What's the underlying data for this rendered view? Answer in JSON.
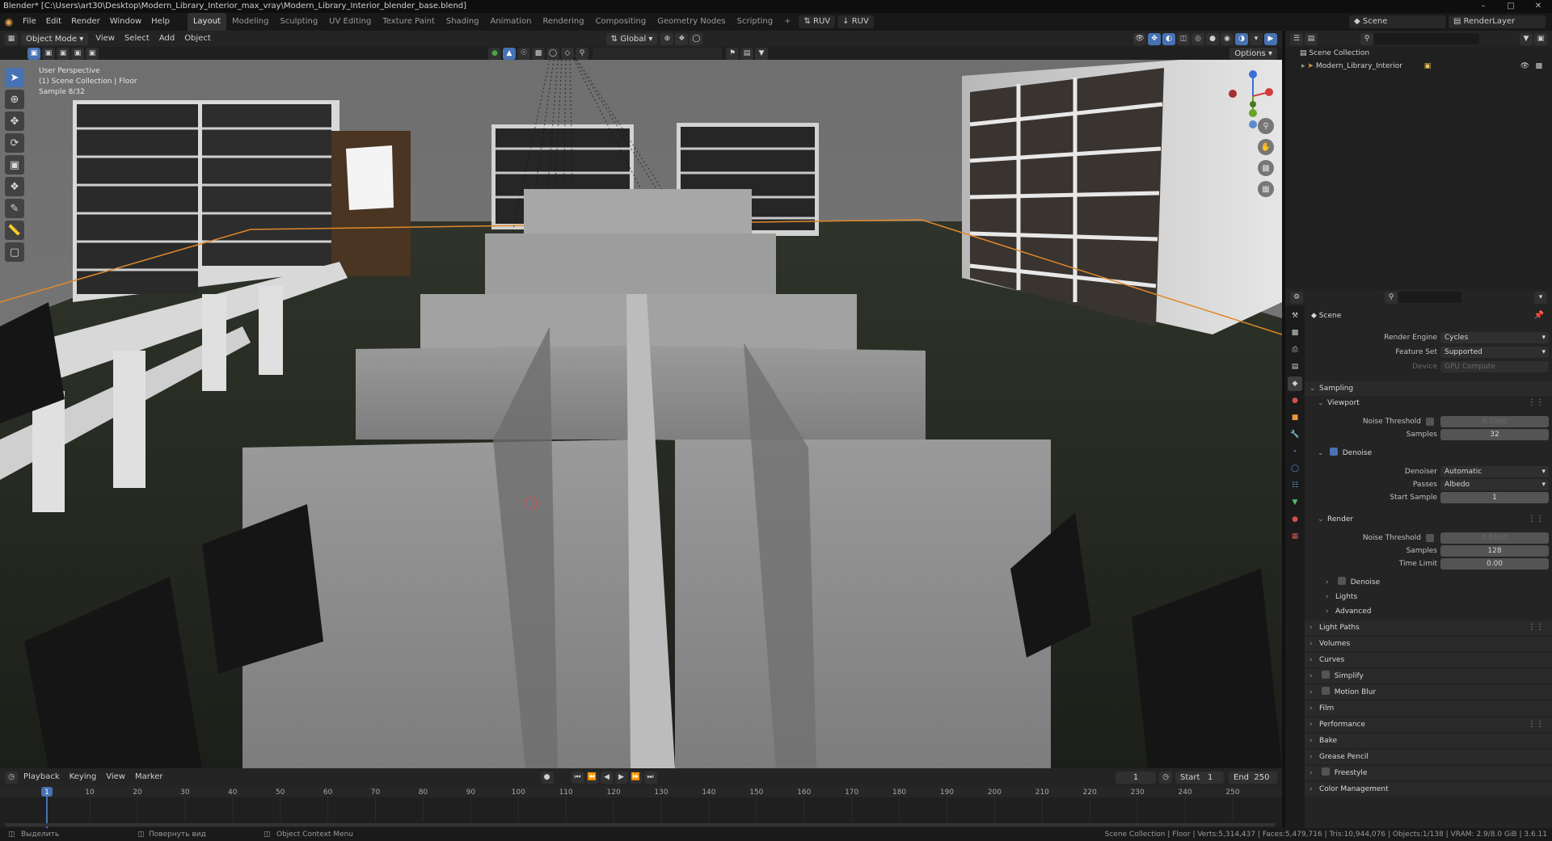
{
  "window": {
    "title": "Blender* [C:\\Users\\art30\\Desktop\\Modern_Library_Interior_max_vray\\Modern_Library_Interior_blender_base.blend]",
    "controls": [
      "–",
      "□",
      "✕"
    ]
  },
  "menubar": {
    "menus": [
      "File",
      "Edit",
      "Render",
      "Window",
      "Help"
    ],
    "workspaces": [
      "Layout",
      "Modeling",
      "Sculpting",
      "UV Editing",
      "Texture Paint",
      "Shading",
      "Animation",
      "Rendering",
      "Compositing",
      "Geometry Nodes",
      "Scripting"
    ],
    "active_workspace": "Layout",
    "add_tab": "+",
    "ruv1": "RUV",
    "ruv2": "RUV",
    "scene": "Scene",
    "view_layer": "RenderLayer"
  },
  "viewport_header": {
    "mode": "Object Mode",
    "menus": [
      "View",
      "Select",
      "Add",
      "Object"
    ],
    "orientation": "Global",
    "options": "Options"
  },
  "viewport": {
    "info_line1": "User Perspective",
    "info_line2": "(1) Scene Collection | Floor",
    "info_line3": "Sample 8/32"
  },
  "timeline": {
    "menus": [
      "Playback",
      "Keying",
      "View",
      "Marker"
    ],
    "current_frame": "1",
    "start_label": "Start",
    "start": "1",
    "end_label": "End",
    "end": "250",
    "ticks": [
      "1",
      "10",
      "20",
      "30",
      "40",
      "50",
      "60",
      "70",
      "80",
      "90",
      "100",
      "110",
      "120",
      "130",
      "140",
      "150",
      "160",
      "170",
      "180",
      "190",
      "200",
      "210",
      "220",
      "230",
      "240",
      "250"
    ],
    "playhead_frame": 1
  },
  "statusbar": {
    "left1": "Выделить",
    "left2": "Повернуть вид",
    "left3": "Object Context Menu",
    "right": "Scene Collection | Floor | Verts:5,314,437 | Faces:5,479,716 | Tris:10,944,076 | Objects:1/138 | VRAM: 2.9/8.0 GiB | 3.6.11"
  },
  "outliner": {
    "root": "Scene Collection",
    "child": "Modern_Library_Interior"
  },
  "properties": {
    "context": "Scene",
    "render_engine_label": "Render Engine",
    "render_engine": "Cycles",
    "feature_set_label": "Feature Set",
    "feature_set": "Supported",
    "device_label": "Device",
    "device": "GPU Compute",
    "sampling": "Sampling",
    "viewport": "Viewport",
    "noise_threshold_label": "Noise Threshold",
    "vp_noise_threshold": "0.1000",
    "samples_label": "Samples",
    "vp_samples": "32",
    "denoise": "Denoise",
    "denoiser_label": "Denoiser",
    "denoiser": "Automatic",
    "passes_label": "Passes",
    "passes": "Albedo",
    "start_sample_label": "Start Sample",
    "start_sample": "1",
    "render": "Render",
    "r_noise_threshold": "0.0100",
    "r_samples": "128",
    "time_limit_label": "Time Limit",
    "time_limit": "0.00",
    "r_denoise": "Denoise",
    "lights": "Lights",
    "advanced": "Advanced",
    "panels": [
      "Light Paths",
      "Volumes",
      "Curves",
      "Simplify",
      "Motion Blur",
      "Film",
      "Performance",
      "Bake",
      "Grease Pencil",
      "Freestyle",
      "Color Management"
    ]
  }
}
